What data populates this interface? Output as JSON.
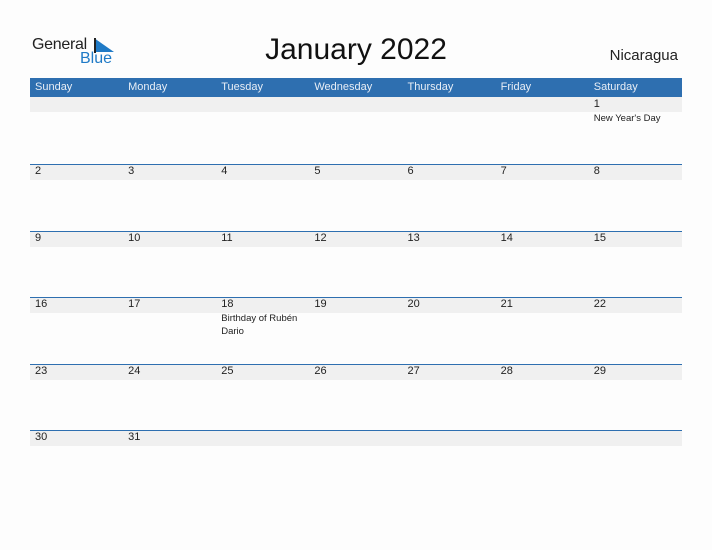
{
  "logo": {
    "general": "General",
    "blue": "Blue"
  },
  "title": "January 2022",
  "country": "Nicaragua",
  "colors": {
    "accent": "#2e6fb0",
    "row_band": "#f0f0f0",
    "logo_blue": "#1f7ac6"
  },
  "weekdays": [
    "Sunday",
    "Monday",
    "Tuesday",
    "Wednesday",
    "Thursday",
    "Friday",
    "Saturday"
  ],
  "weeks": [
    [
      {
        "day": ""
      },
      {
        "day": ""
      },
      {
        "day": ""
      },
      {
        "day": ""
      },
      {
        "day": ""
      },
      {
        "day": ""
      },
      {
        "day": "1",
        "event": "New Year's Day"
      }
    ],
    [
      {
        "day": "2"
      },
      {
        "day": "3"
      },
      {
        "day": "4"
      },
      {
        "day": "5"
      },
      {
        "day": "6"
      },
      {
        "day": "7"
      },
      {
        "day": "8"
      }
    ],
    [
      {
        "day": "9"
      },
      {
        "day": "10"
      },
      {
        "day": "11"
      },
      {
        "day": "12"
      },
      {
        "day": "13"
      },
      {
        "day": "14"
      },
      {
        "day": "15"
      }
    ],
    [
      {
        "day": "16"
      },
      {
        "day": "17"
      },
      {
        "day": "18",
        "event": "Birthday of Rubén Dario"
      },
      {
        "day": "19"
      },
      {
        "day": "20"
      },
      {
        "day": "21"
      },
      {
        "day": "22"
      }
    ],
    [
      {
        "day": "23"
      },
      {
        "day": "24"
      },
      {
        "day": "25"
      },
      {
        "day": "26"
      },
      {
        "day": "27"
      },
      {
        "day": "28"
      },
      {
        "day": "29"
      }
    ],
    [
      {
        "day": "30"
      },
      {
        "day": "31"
      },
      {
        "day": ""
      },
      {
        "day": ""
      },
      {
        "day": ""
      },
      {
        "day": ""
      },
      {
        "day": ""
      }
    ]
  ]
}
